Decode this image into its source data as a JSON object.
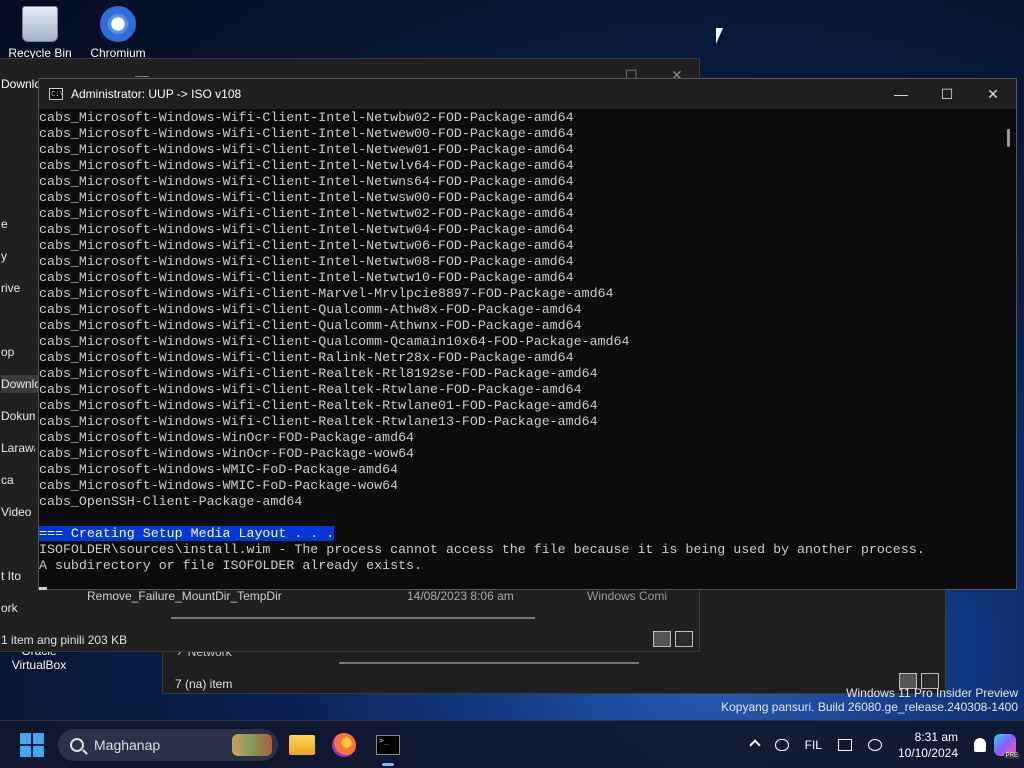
{
  "desktop": {
    "icons": [
      {
        "label": "Recycle Bin"
      },
      {
        "label": "Chromium"
      }
    ],
    "oracle_label_line1": "Oracle",
    "oracle_label_line2": "VirtualBox"
  },
  "explorer_front": {
    "title_fragment": "Download",
    "sidebar": [
      "e",
      "y",
      "rive",
      "op",
      "Downlo",
      "Dokume",
      "Larawa",
      "ca",
      "Video",
      "t Ito",
      "ork"
    ],
    "file_row": {
      "name": "Remove_Failure_MountDir_TempDir",
      "date": "14/08/2023 8:06 am",
      "type": "Windows Comi"
    },
    "status": "1 item ang pinili  203 KB"
  },
  "explorer_back": {
    "network_label": "Network",
    "status": "7 (na) item"
  },
  "terminal": {
    "title": "Administrator:  UUP -> ISO v108",
    "lines": [
      "cabs_Microsoft-Windows-Wifi-Client-Intel-Netwbw02-FOD-Package-amd64",
      "cabs_Microsoft-Windows-Wifi-Client-Intel-Netwew00-FOD-Package-amd64",
      "cabs_Microsoft-Windows-Wifi-Client-Intel-Netwew01-FOD-Package-amd64",
      "cabs_Microsoft-Windows-Wifi-Client-Intel-Netwlv64-FOD-Package-amd64",
      "cabs_Microsoft-Windows-Wifi-Client-Intel-Netwns64-FOD-Package-amd64",
      "cabs_Microsoft-Windows-Wifi-Client-Intel-Netwsw00-FOD-Package-amd64",
      "cabs_Microsoft-Windows-Wifi-Client-Intel-Netwtw02-FOD-Package-amd64",
      "cabs_Microsoft-Windows-Wifi-Client-Intel-Netwtw04-FOD-Package-amd64",
      "cabs_Microsoft-Windows-Wifi-Client-Intel-Netwtw06-FOD-Package-amd64",
      "cabs_Microsoft-Windows-Wifi-Client-Intel-Netwtw08-FOD-Package-amd64",
      "cabs_Microsoft-Windows-Wifi-Client-Intel-Netwtw10-FOD-Package-amd64",
      "cabs_Microsoft-Windows-Wifi-Client-Marvel-Mrvlpcie8897-FOD-Package-amd64",
      "cabs_Microsoft-Windows-Wifi-Client-Qualcomm-Athw8x-FOD-Package-amd64",
      "cabs_Microsoft-Windows-Wifi-Client-Qualcomm-Athwnx-FOD-Package-amd64",
      "cabs_Microsoft-Windows-Wifi-Client-Qualcomm-Qcamain10x64-FOD-Package-amd64",
      "cabs_Microsoft-Windows-Wifi-Client-Ralink-Netr28x-FOD-Package-amd64",
      "cabs_Microsoft-Windows-Wifi-Client-Realtek-Rtl8192se-FOD-Package-amd64",
      "cabs_Microsoft-Windows-Wifi-Client-Realtek-Rtwlane-FOD-Package-amd64",
      "cabs_Microsoft-Windows-Wifi-Client-Realtek-Rtwlane01-FOD-Package-amd64",
      "cabs_Microsoft-Windows-Wifi-Client-Realtek-Rtwlane13-FOD-Package-amd64",
      "cabs_Microsoft-Windows-WinOcr-FOD-Package-amd64",
      "cabs_Microsoft-Windows-WinOcr-FOD-Package-wow64",
      "cabs_Microsoft-Windows-WMIC-FoD-Package-amd64",
      "cabs_Microsoft-Windows-WMIC-FoD-Package-wow64",
      "cabs_OpenSSH-Client-Package-amd64",
      ""
    ],
    "highlight_line": "=== Creating Setup Media Layout . . .",
    "after_lines": [
      "ISOFOLDER\\sources\\install.wim - The process cannot access the file because it is being used by another process.",
      "A subdirectory or file ISOFOLDER already exists."
    ],
    "highlight_color": "#0037da"
  },
  "watermark": {
    "line1": "Windows 11 Pro Insider Preview",
    "line2": "Kopyang pansuri. Build 26080.ge_release.240308-1400"
  },
  "taskbar": {
    "search_placeholder": "Maghanap",
    "language": "FIL",
    "time": "8:31 am",
    "date": "10/10/2024",
    "copilot_badge": "PRE"
  }
}
